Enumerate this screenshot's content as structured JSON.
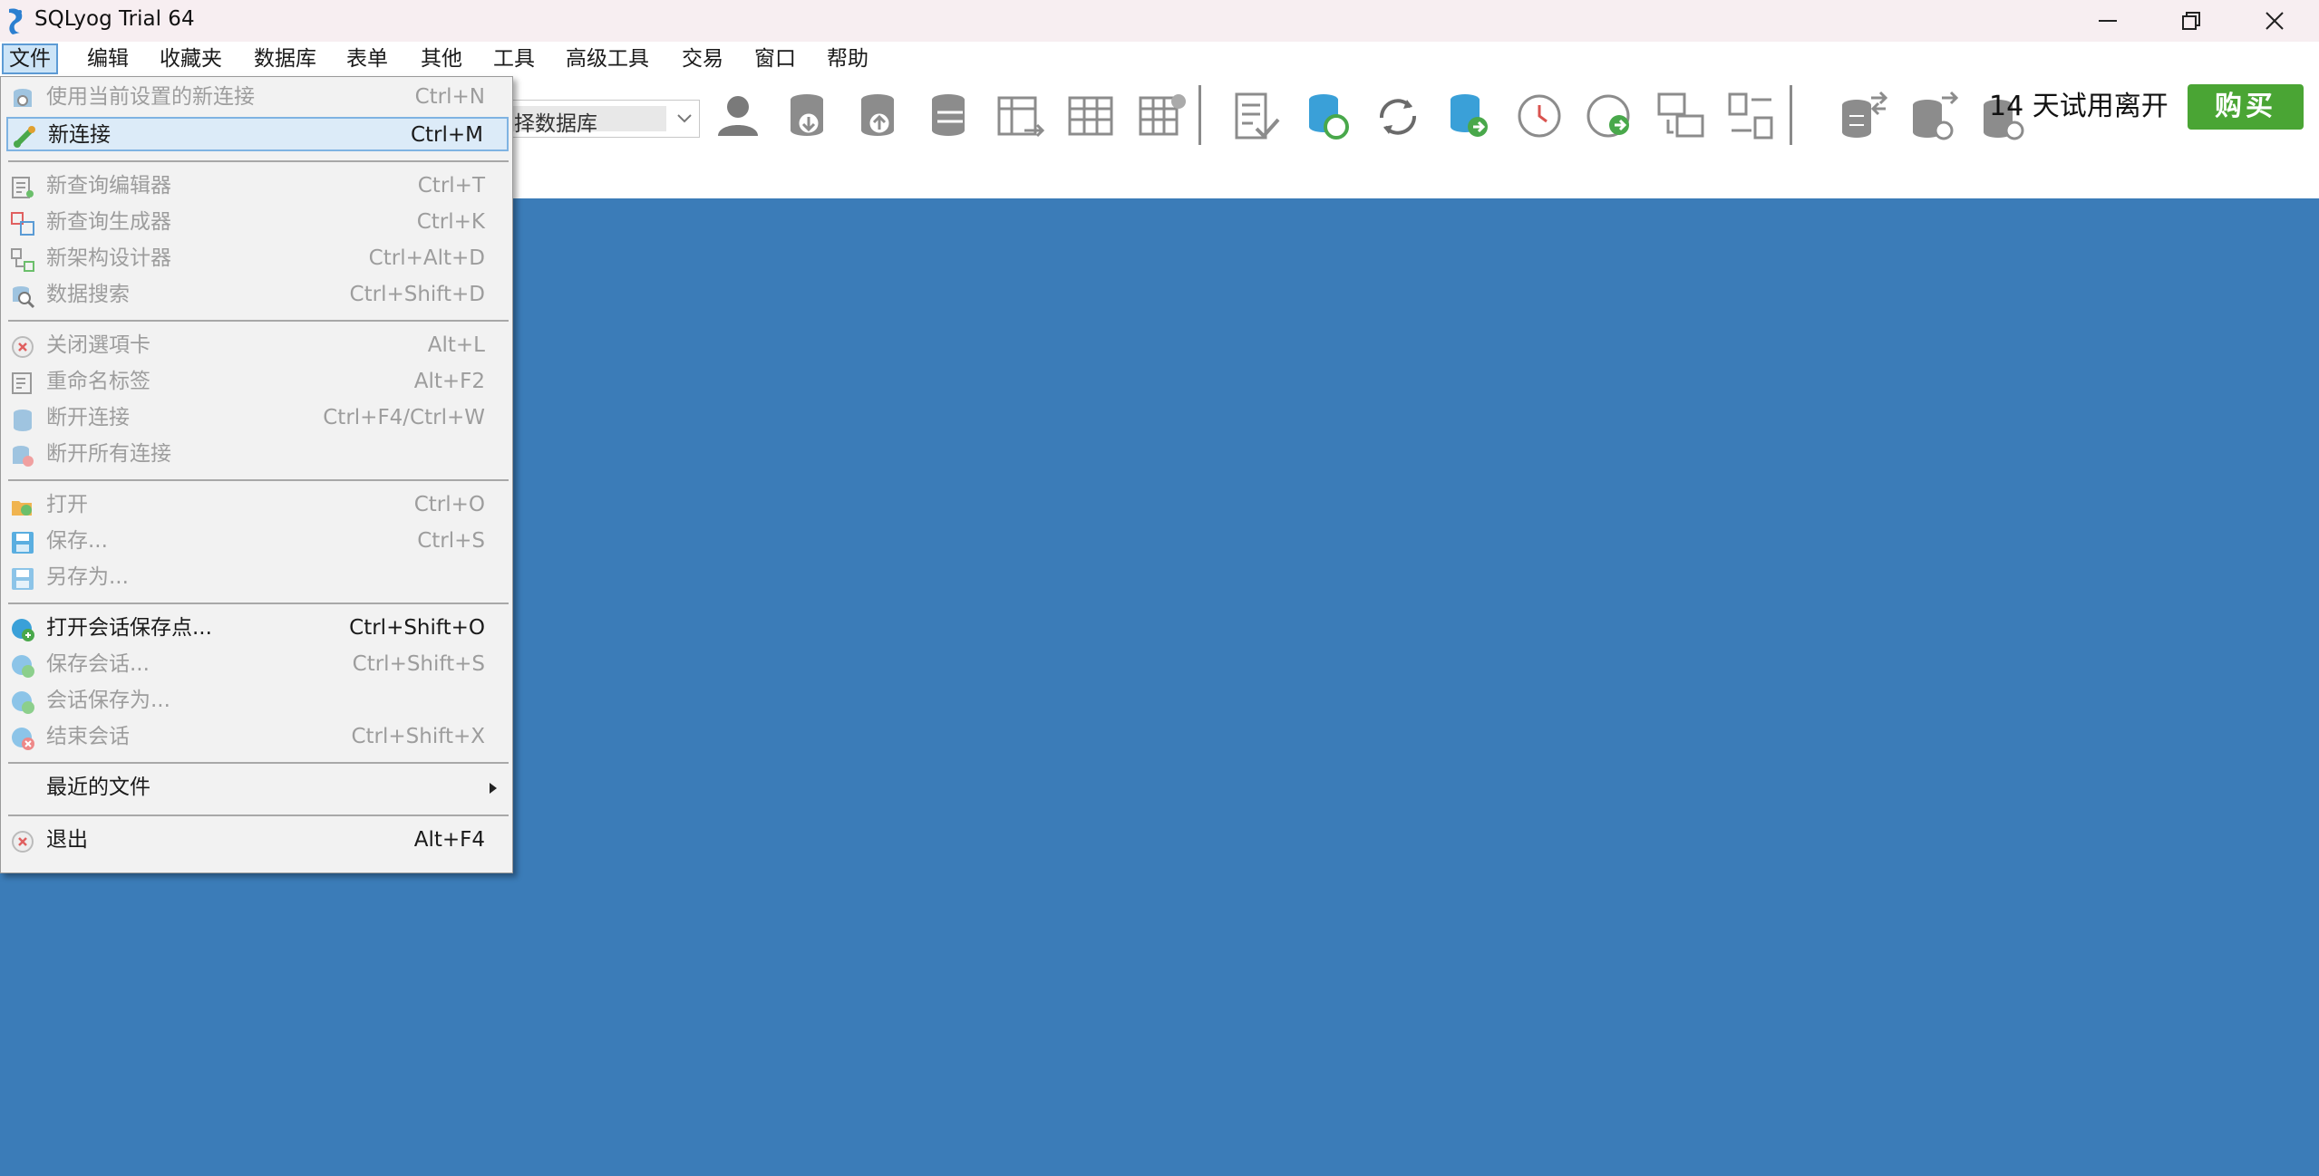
{
  "window": {
    "title": "SQLyog Trial 64",
    "controls": [
      "minimize-icon",
      "restore-icon",
      "close-icon"
    ]
  },
  "menubar": {
    "items": [
      {
        "label": "文件",
        "active": true
      },
      {
        "label": "编辑"
      },
      {
        "label": "收藏夹"
      },
      {
        "label": "数据库"
      },
      {
        "label": "表单"
      },
      {
        "label": "其他"
      },
      {
        "label": "工具"
      },
      {
        "label": "高级工具"
      },
      {
        "label": "交易"
      },
      {
        "label": "窗口"
      },
      {
        "label": "帮助"
      }
    ]
  },
  "toolbar": {
    "db_select_value": "择数据库",
    "trial_text": "14 天试用离开",
    "buy_label": "购买",
    "icons": [
      "user-icon",
      "db-download-icon",
      "db-upload-icon",
      "db-copy-icon",
      "table-export-icon",
      "table-grid-icon",
      "table-settings-icon",
      "query-check-icon",
      "db-refresh-icon",
      "refresh-icon",
      "db-run-icon",
      "clock-icon",
      "schedule-run-icon",
      "schema-sync-icon",
      "data-compare-icon",
      "db-sync-icon",
      "db-check-icon",
      "db-restore-icon"
    ],
    "colors": {
      "buy": "#4aa534",
      "icon_gray": "#8c8c8c",
      "icon_blue": "#3aa0d8",
      "icon_green": "#49a84b"
    }
  },
  "file_menu": {
    "items": [
      {
        "label": "使用当前设置的新连接",
        "shortcut": "Ctrl+N",
        "enabled": false,
        "icon": "gear-db-icon"
      },
      {
        "label": "新连接",
        "shortcut": "Ctrl+M",
        "enabled": true,
        "highlighted": true,
        "icon": "connect-icon"
      },
      {
        "label": "新查询编辑器",
        "shortcut": "Ctrl+T",
        "enabled": false,
        "icon": "query-editor-icon"
      },
      {
        "label": "新查询生成器",
        "shortcut": "Ctrl+K",
        "enabled": false,
        "icon": "query-builder-icon"
      },
      {
        "label": "新架构设计器",
        "shortcut": "Ctrl+Alt+D",
        "enabled": false,
        "icon": "schema-designer-icon"
      },
      {
        "label": "数据搜索",
        "shortcut": "Ctrl+Shift+D",
        "enabled": false,
        "icon": "data-search-icon"
      },
      {
        "label": "关闭選項卡",
        "shortcut": "Alt+L",
        "enabled": false,
        "icon": "close-tab-icon"
      },
      {
        "label": "重命名标签",
        "shortcut": "Alt+F2",
        "enabled": false,
        "icon": "rename-icon"
      },
      {
        "label": "断开连接",
        "shortcut": "Ctrl+F4/Ctrl+W",
        "enabled": false,
        "icon": "disconnect-icon"
      },
      {
        "label": "断开所有连接",
        "shortcut": "",
        "enabled": false,
        "icon": "disconnect-all-icon"
      },
      {
        "label": "打开",
        "shortcut": "Ctrl+O",
        "enabled": false,
        "icon": "open-folder-icon"
      },
      {
        "label": "保存...",
        "shortcut": "Ctrl+S",
        "enabled": false,
        "icon": "save-icon"
      },
      {
        "label": "另存为...",
        "shortcut": "",
        "enabled": false,
        "icon": "save-as-icon"
      },
      {
        "label": "打开会话保存点...",
        "shortcut": "Ctrl+Shift+O",
        "enabled": true,
        "icon": "open-session-icon"
      },
      {
        "label": "保存会话...",
        "shortcut": "Ctrl+Shift+S",
        "enabled": false,
        "icon": "save-session-icon"
      },
      {
        "label": "会话保存为...",
        "shortcut": "",
        "enabled": false,
        "icon": "save-session-as-icon"
      },
      {
        "label": "结束会话",
        "shortcut": "Ctrl+Shift+X",
        "enabled": false,
        "icon": "end-session-icon"
      },
      {
        "label": "最近的文件",
        "shortcut": "",
        "enabled": true,
        "submenu": true
      },
      {
        "label": "退出",
        "shortcut": "Alt+F4",
        "enabled": true,
        "icon": "exit-icon"
      }
    ]
  },
  "colors": {
    "workspace": "#3b7cb8",
    "menu_bg": "#f2f2f2",
    "highlight": "#dcebf8",
    "disabled_text": "#9d9d9d"
  }
}
